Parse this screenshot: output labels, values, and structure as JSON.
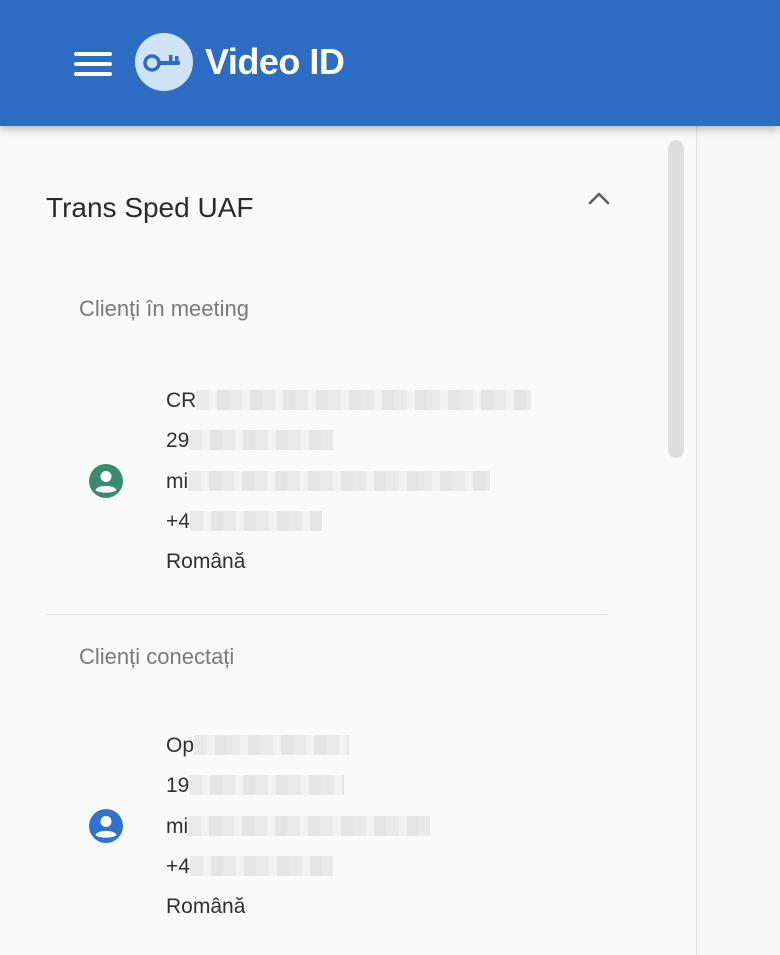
{
  "header": {
    "title": "Video ID",
    "menu_icon": "hamburger-menu-icon",
    "logo_icon": "key-logo-icon",
    "background": "#2e6bc2"
  },
  "group": {
    "title": "Trans Sped UAF",
    "toggle_icon": "chevron-up-icon",
    "expanded": true
  },
  "sections": [
    {
      "title": "Clienți în meeting",
      "clients": [
        {
          "avatar_icon": "account-circle-icon",
          "avatar_color": "#3a8a6c",
          "name_prefix": "CR",
          "id_prefix": "29",
          "email_prefix": "mi",
          "phone_prefix": "+4",
          "language": "Română"
        }
      ]
    },
    {
      "title": "Clienți conectați",
      "clients": [
        {
          "avatar_icon": "account-circle-icon",
          "avatar_color": "#2f73cf",
          "name_prefix": "Op",
          "id_prefix": "19",
          "email_prefix": "mi",
          "phone_prefix": "+4",
          "language": "Română"
        }
      ]
    }
  ]
}
